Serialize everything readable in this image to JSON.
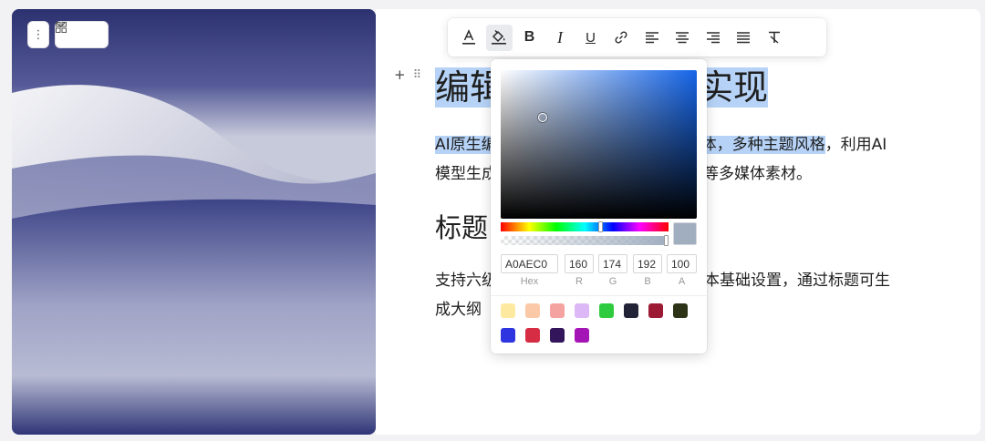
{
  "image_controls": {
    "more_icon": "more-vertical-icon",
    "layout_icon": "grid-icon",
    "chevron_icon": "chevron-down-icon"
  },
  "block_handle": {
    "add": "+",
    "drag": "⠿"
  },
  "document": {
    "heading1": {
      "visible_left": "编辑",
      "visible_right": "实现"
    },
    "paragraph1": {
      "line1_left": "AI原生编",
      "line1_right_selected": "体，多种主题风格",
      "line1_tail": "，利用AI",
      "line2_left": "模型生成",
      "line2_right": "等多媒体素材。"
    },
    "heading2": {
      "visible_left": "标题"
    },
    "paragraph2": {
      "line1_left": "支持六级",
      "line1_right": "本基础设置，通过标题可生",
      "line2_left": "成大纲"
    }
  },
  "toolbar": {
    "buttons": [
      {
        "name": "font-color-button",
        "icon": "font-color-icon",
        "glyph": "A"
      },
      {
        "name": "highlight-color-button",
        "icon": "paint-bucket-icon",
        "glyph": "",
        "active": true
      },
      {
        "name": "bold-button",
        "icon": "bold-icon",
        "glyph": "B"
      },
      {
        "name": "italic-button",
        "icon": "italic-icon",
        "glyph": "I"
      },
      {
        "name": "underline-button",
        "icon": "underline-icon",
        "glyph": "U"
      },
      {
        "name": "link-button",
        "icon": "link-icon",
        "glyph": ""
      },
      {
        "name": "align-left-button",
        "icon": "align-left-icon",
        "glyph": ""
      },
      {
        "name": "align-center-button",
        "icon": "align-center-icon",
        "glyph": ""
      },
      {
        "name": "align-right-button",
        "icon": "align-right-icon",
        "glyph": ""
      },
      {
        "name": "align-justify-button",
        "icon": "align-justify-icon",
        "glyph": ""
      },
      {
        "name": "clear-format-button",
        "icon": "clear-format-icon",
        "glyph": ""
      }
    ]
  },
  "color_picker": {
    "hex": "A0AEC0",
    "r": "160",
    "g": "174",
    "b": "192",
    "a": "100",
    "labels": {
      "hex": "Hex",
      "r": "R",
      "g": "G",
      "b": "B",
      "a": "A"
    },
    "current_color": "#a0aec0",
    "hue_base": "#1565e8",
    "hue_position": 0.595,
    "alpha_position": 1.0,
    "preset_colors": [
      "#fde9a0",
      "#fcc9a8",
      "#f4a3a0",
      "#dcb8f6",
      "#2ecb3e",
      "#222336",
      "#9d1a35",
      "#2d3316",
      "#2e35e0",
      "#d72d44",
      "#32155a",
      "#a415b6"
    ]
  },
  "colors": {
    "selection": "#b6d3f7",
    "text": "#1f1f1f"
  }
}
